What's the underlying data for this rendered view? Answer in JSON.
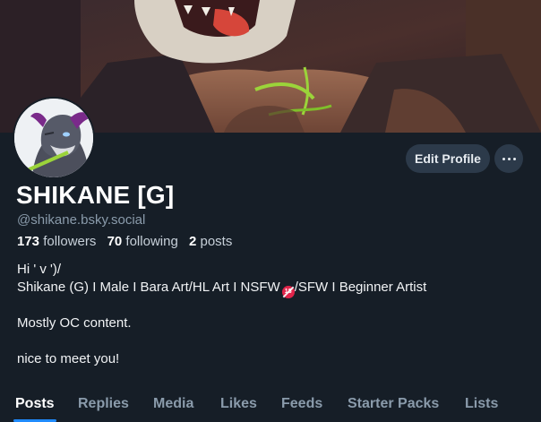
{
  "profile": {
    "display_name": "SHIKANE [G]",
    "handle": "@shikane.bsky.social",
    "followers_count": "173",
    "followers_label": "followers",
    "following_count": "70",
    "following_label": "following",
    "posts_count": "2",
    "posts_label": "posts",
    "bio": {
      "line1": "Hi ' v ')/",
      "line2a": "Shikane (G) I Male I Bara Art/HL Art I NSFW",
      "line2b": "/SFW I Beginner Artist",
      "line3": "Mostly OC content.",
      "line4": "nice to meet you!"
    }
  },
  "actions": {
    "edit_profile_label": "Edit Profile",
    "more_icon": "ellipsis-icon"
  },
  "tabs": [
    {
      "label": "Posts",
      "active": true
    },
    {
      "label": "Replies",
      "active": false
    },
    {
      "label": "Media",
      "active": false
    },
    {
      "label": "Likes",
      "active": false
    },
    {
      "label": "Feeds",
      "active": false
    },
    {
      "label": "Starter Packs",
      "active": false
    },
    {
      "label": "Lists",
      "active": false
    }
  ],
  "colors": {
    "background": "#161e27",
    "accent": "#208bfe",
    "muted_text": "#8a9bab",
    "button_bg": "#2c3a4a",
    "nsfw_badge": "#e0244a"
  }
}
